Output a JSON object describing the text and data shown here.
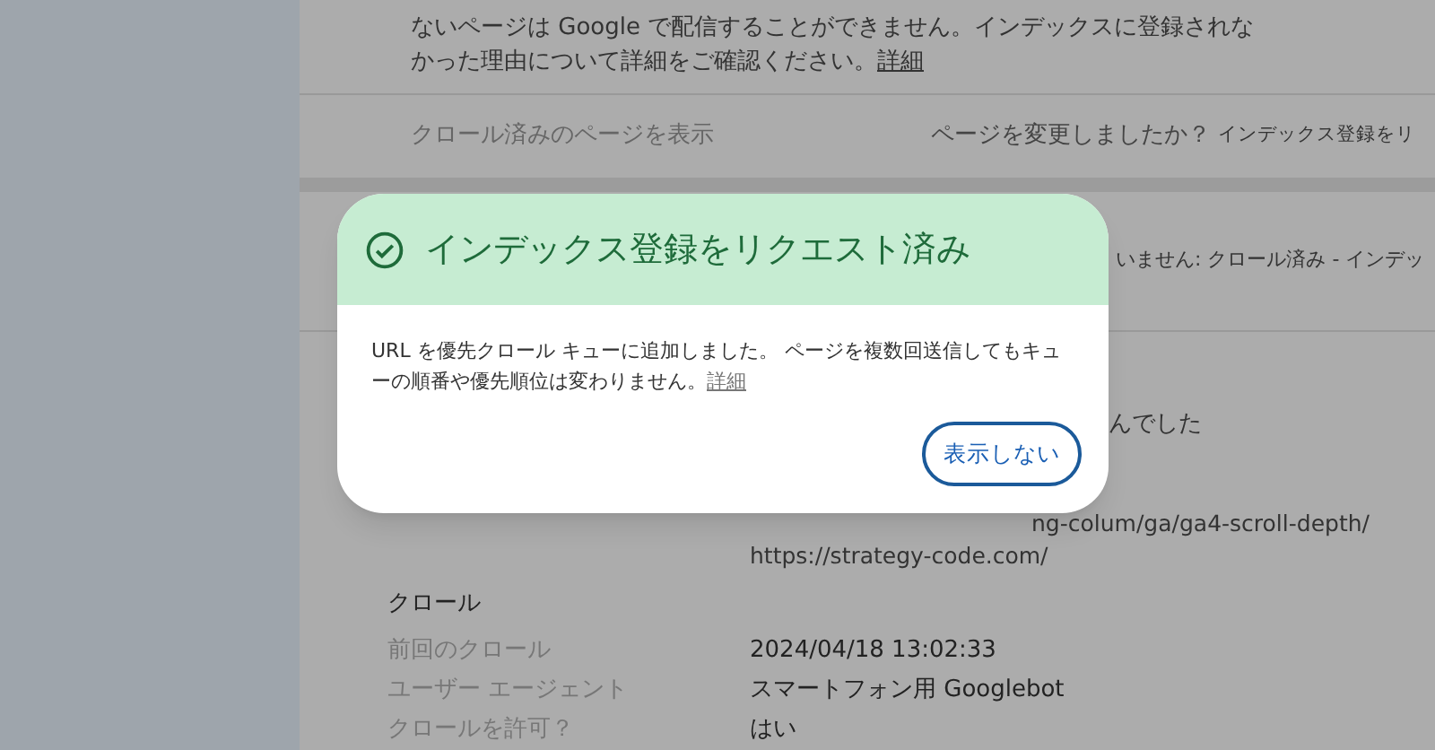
{
  "card_top": {
    "lines": [
      "ないページは Google で配信することができません。インデックスに登録されな",
      "かった理由について詳細をご確認ください。"
    ],
    "link": "詳細",
    "view_crawled": "クロール済みのページを表示",
    "changed_question": "ページを変更しましたか？",
    "request_index": "インデックス登録をリ"
  },
  "card_detail": {
    "status": "いません: クロール済み - インデッ",
    "note": "んでした",
    "url_tail": "ng-colum/ga/ga4-scroll-depth/",
    "url": "https://strategy-code.com/",
    "section": "クロール",
    "rows": [
      {
        "label": "前回のクロール",
        "value": "2024/04/18 13:02:33"
      },
      {
        "label": "ユーザー エージェント",
        "value": "スマートフォン用 Googlebot"
      },
      {
        "label": "クロールを許可？",
        "value": "はい"
      }
    ]
  },
  "dialog": {
    "title": "インデックス登録をリクエスト済み",
    "body": "URL を優先クロール キューに追加しました。 ページを複数回送信してもキューの順番や優先順位は変わりません。",
    "link": "詳細",
    "button": "表示しない"
  }
}
